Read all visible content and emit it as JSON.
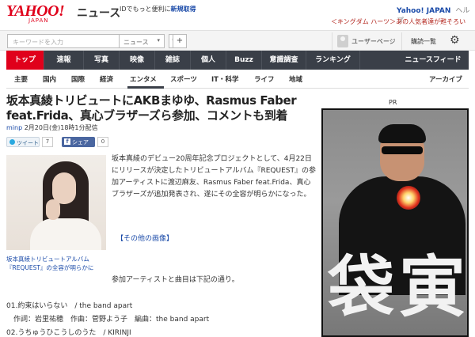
{
  "header": {
    "logo": "YAHOO!",
    "logo_sub": "JAPAN",
    "title": "ニュース",
    "promo_prefix": "IDでもっと便利に",
    "promo_link": "新規取得",
    "yahoo_japan": "Yahoo! JAPAN",
    "help": "ヘルプ",
    "top_link": "＜キングダム ハーツ＞あの人気者達が甦そろい"
  },
  "search": {
    "placeholder": "キーワードを入力",
    "scope": "ニュース",
    "search_btn": "🔍",
    "add_btn": "+",
    "user_page": "ユーザーページ",
    "history": "購読一覧"
  },
  "nav": {
    "items": [
      "トップ",
      "速報",
      "写真",
      "映像",
      "雑誌",
      "個人",
      "Buzz",
      "意識調査",
      "ランキング"
    ],
    "feed": "ニュースフィード"
  },
  "subnav": {
    "items": [
      "主要",
      "国内",
      "国際",
      "経済",
      "エンタメ",
      "スポーツ",
      "IT・科学",
      "ライフ",
      "地域"
    ],
    "archive": "アーカイブ"
  },
  "article": {
    "headline": "坂本真綾トリビュートにAKBまゆゆ、Rasmus Faber feat.Frida、真心ブラザーズら参加、コメントも到着",
    "source": "minp",
    "date": "2月20日(金)18時1分配信",
    "tweet_label": "ツイート",
    "tweet_count": "7",
    "share_label": "シェア",
    "share_count": "0",
    "caption": "坂本真綾トリビュートアルバム『REQUEST』の全容が明らかに",
    "para1": "坂本真綾のデビュー20周年記念プロジェクトとして、4月22日にリリースが決定したトリビュートアルバム『REQUEST』の参加アーティストに渡辺麻友、Rasmus Faber feat.Frida、真心ブラザーズが追加発表され、遂にその全容が明らかになった。",
    "more_images": "【その他の画像】",
    "para2": "参加アーティストと曲目は下記の通り。",
    "tracklist": [
      "01.約束はいらない　/ the band apart",
      "　作詞：岩里祐穂　作曲：菅野よう子　編曲：the band apart",
      "02.うちゅうひこうしのうた　/ KIRINJI"
    ]
  },
  "ad": {
    "pr": "PR",
    "kanji1": "袋",
    "kanji2": "寅"
  }
}
